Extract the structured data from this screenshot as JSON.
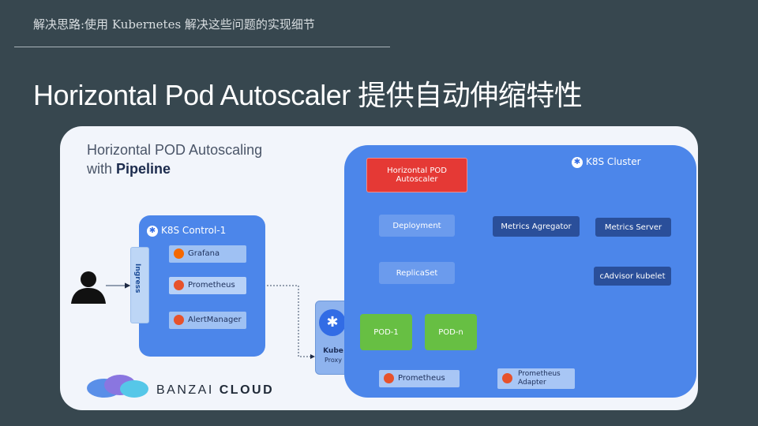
{
  "slide": {
    "subtitle": "解决思路:使用 Kubernetes 解决这些问题的实现细节",
    "title": "Horizontal Pod Autoscaler 提供自动伸缩特性"
  },
  "diagram": {
    "title_line1": "Horizontal POD Autoscaling",
    "title_line2_prefix": "with ",
    "title_line2_bold": "Pipeline",
    "control_plane_label": "K8S Control-1",
    "cluster_label": "K8S Cluster",
    "ingress_label": "Ingress",
    "services": [
      "Grafana",
      "Prometheus",
      "AlertManager"
    ],
    "kube_proxy": {
      "line1": "Kube",
      "line2": "Proxy"
    },
    "hpa_line1": "Horizontal POD",
    "hpa_line2": "Autoscaler",
    "deployment": "Deployment",
    "replicaset": "ReplicaSet",
    "pod1": "POD-1",
    "podn": "POD-n",
    "metrics_aggregator": "Metrics Agregator",
    "metrics_server": "Metrics Server",
    "cadvisor": "cAdvisor kubelet",
    "prometheus_bottom": "Prometheus",
    "prometheus_adapter_line1": "Prometheus",
    "prometheus_adapter_line2": "Adapter",
    "logo_word1": "BANZAI",
    "logo_word2": "CLOUD"
  },
  "colors": {
    "background": "#37474f",
    "panel": "#f2f5fb",
    "cluster_blue": "#4c86ea",
    "hpa_red": "#e53935",
    "pod_green": "#67bf43",
    "dark_box": "#2a4f9a"
  },
  "icons": [
    "user-icon",
    "kubernetes-helm-icon",
    "grafana-icon",
    "prometheus-icon",
    "banzai-cloud-logo"
  ]
}
